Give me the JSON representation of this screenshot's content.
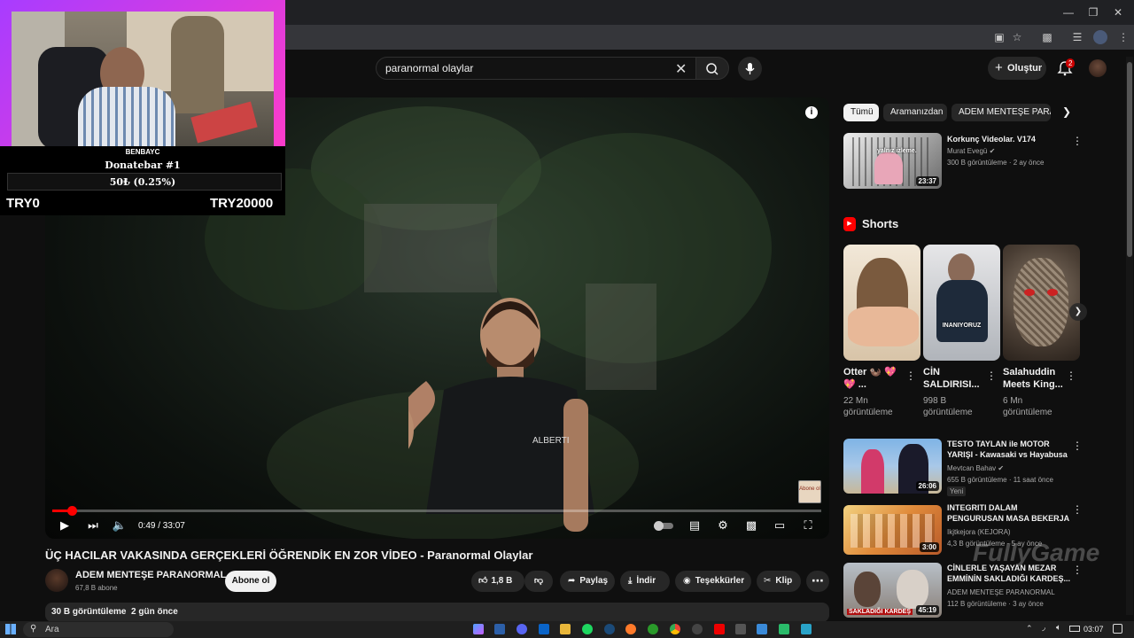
{
  "search": {
    "query": "paranormal olaylar"
  },
  "header": {
    "create_label": "Oluştur",
    "notification_count": "2"
  },
  "overlay": {
    "donate_name": "BENBAYC",
    "donate_title": "Donatebar #1",
    "donate_progress": "50₺ (0.25%)",
    "donate_min": "TRY0",
    "donate_max": "TRY20000"
  },
  "video": {
    "time": "0:49 / 33:07",
    "progress_fraction": 0.025,
    "subscribe_badge": "Abone ol",
    "title": "ÜÇ HACILAR VAKASINDA GERÇEKLERİ ÖĞRENDİK EN ZOR VİDEO - Paranormal Olaylar",
    "channel": "ADEM MENTEŞE PARANORMAL",
    "subscribers": "67,8 B abone",
    "subscribe_label": "Abone ol",
    "likes": "1,8 B",
    "share_label": "Paylaş",
    "download_label": "İndir",
    "thanks_label": "Teşekkürler",
    "clip_label": "Klip",
    "views_date": "30 B görüntüleme  2 gün önce"
  },
  "chips": [
    "Tümü",
    "Aramanızdan",
    "ADEM MENTEŞE PARAN"
  ],
  "recommended_top": {
    "title": "Korkunç Videolar. V174",
    "channel": "Murat Evegü",
    "meta": "300 B görüntüleme · 2 ay önce",
    "duration": "23:37",
    "thumb_text": "yalnız izleme."
  },
  "shorts": {
    "heading": "Shorts",
    "items": [
      {
        "title": "Otter 🦦 💖 💖 ...",
        "views": "22 Mn görüntüleme"
      },
      {
        "title": "CİN SALDIRISI...",
        "views": "998 B görüntüleme",
        "thumb_text": "INANIYORUZ"
      },
      {
        "title": "Salahuddin Meets King...",
        "views": "6 Mn görüntüleme"
      }
    ]
  },
  "recommended": [
    {
      "title": "TESTO TAYLAN ile MOTOR YARIŞI - Kawasaki vs Hayabusa",
      "channel": "Mevtcan Bahav",
      "meta": "655 B görüntüleme · 11 saat önce",
      "badge": "Yeni",
      "duration": "26:06"
    },
    {
      "title": "INTEGRITI DALAM PENGURUSAN MASA BEKERJA",
      "channel": "Ikjtkejora (KEJORA)",
      "meta": "4,3 B görüntüleme · 5 ay önce",
      "duration": "3:00"
    },
    {
      "title": "CİNLERLE YAŞAYAN MEZAR EMMİNİN SAKLADIĞI KARDEŞ...",
      "channel": "ADEM MENTEŞE PARANORMAL",
      "meta": "112 B görüntüleme · 3 ay önce",
      "duration": "45:19",
      "thumb_text": "SAKLADIĞI KARDEŞ"
    }
  ],
  "watermark": "FullyGame",
  "taskbar": {
    "search_placeholder": "Ara",
    "clock": "03:07"
  },
  "colors": {
    "accent_red": "#ff0000",
    "overlay_pink": "#ff3cc8",
    "overlay_purple": "#a83cff"
  }
}
